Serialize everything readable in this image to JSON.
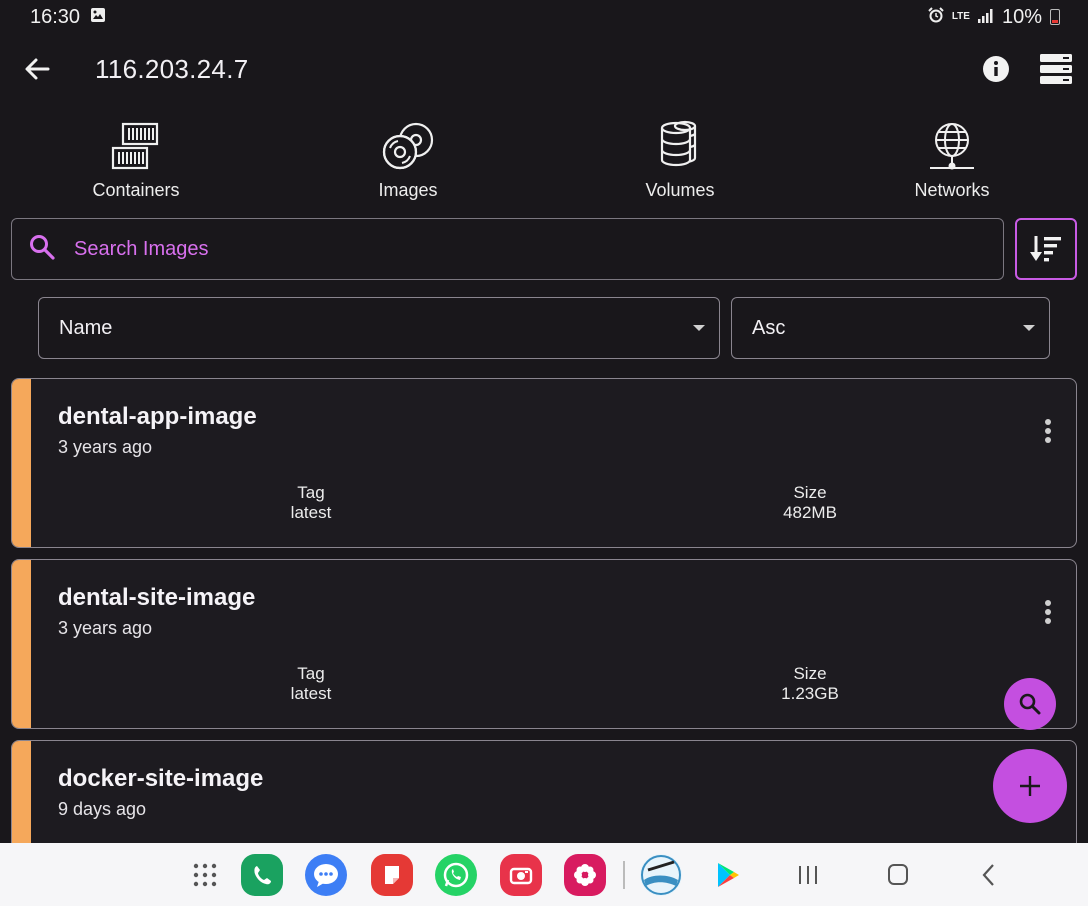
{
  "status_bar": {
    "time": "16:30",
    "network": "LTE",
    "battery": "10%"
  },
  "app_bar": {
    "title": "116.203.24.7"
  },
  "nav_tabs": [
    {
      "label": "Containers",
      "icon": "containers-icon"
    },
    {
      "label": "Images",
      "icon": "images-icon"
    },
    {
      "label": "Volumes",
      "icon": "volumes-icon"
    },
    {
      "label": "Networks",
      "icon": "networks-icon"
    }
  ],
  "search": {
    "placeholder": "Search Images",
    "value": ""
  },
  "sort": {
    "field": "Name",
    "order": "Asc"
  },
  "images": [
    {
      "name": "dental-app-image",
      "age": "3 years ago",
      "tag_label": "Tag",
      "tag": "latest",
      "size_label": "Size",
      "size": "482MB"
    },
    {
      "name": "dental-site-image",
      "age": "3 years ago",
      "tag_label": "Tag",
      "tag": "latest",
      "size_label": "Size",
      "size": "1.23GB"
    },
    {
      "name": "docker-site-image",
      "age": "9 days ago"
    }
  ],
  "colors": {
    "accent": "#c44fe0",
    "stripe": "#f5a85b",
    "background": "#19171b"
  },
  "dock": [
    "app-drawer-icon",
    "phone-icon",
    "messages-icon",
    "notes-icon",
    "whatsapp-icon",
    "camera-icon",
    "gallery-icon",
    "lifetime-icon",
    "play-store-icon"
  ]
}
